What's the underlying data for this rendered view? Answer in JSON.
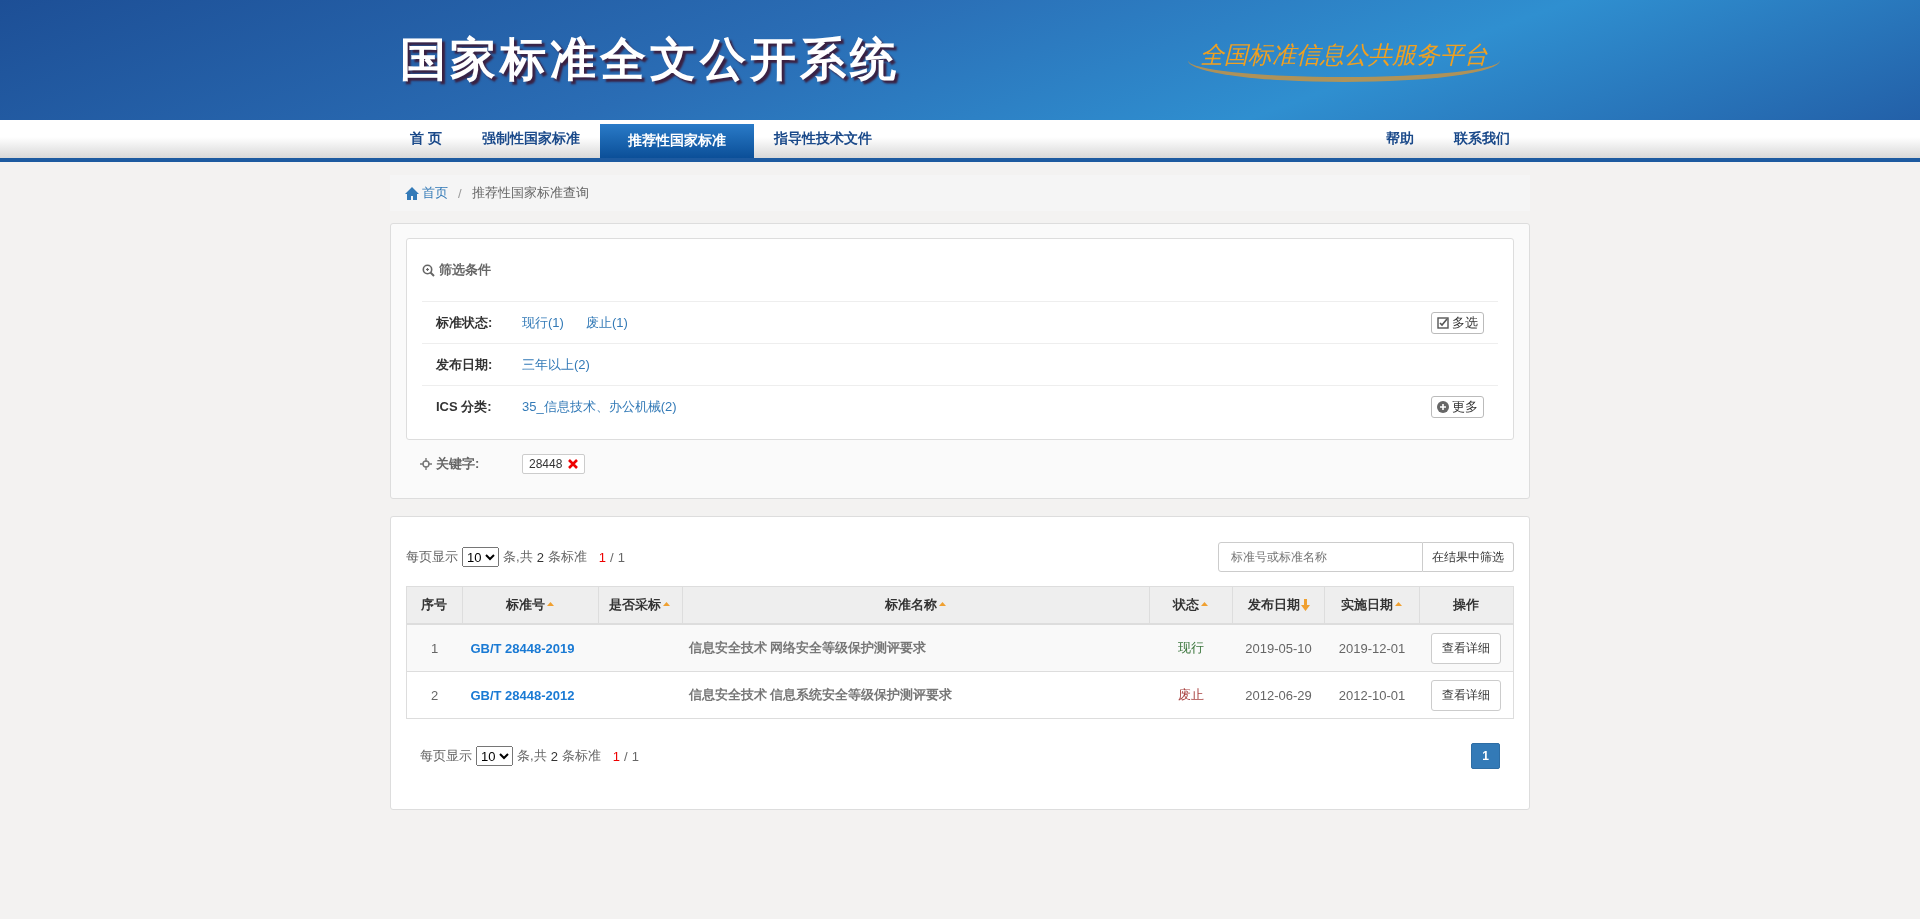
{
  "header": {
    "title": "国家标准全文公开系统",
    "slogan": "全国标准信息公共服务平台"
  },
  "nav": {
    "items": [
      {
        "label": "首 页",
        "selected": false
      },
      {
        "label": "强制性国家标准",
        "selected": false
      },
      {
        "label": "推荐性国家标准",
        "selected": true
      },
      {
        "label": "指导性技术文件",
        "selected": false
      }
    ],
    "right": [
      "帮助",
      "联系我们"
    ]
  },
  "breadcrumb": {
    "home": "首页",
    "separator": "/",
    "current": "推荐性国家标准查询"
  },
  "filter": {
    "title": "筛选条件",
    "rows": [
      {
        "label": "标准状态:",
        "options": [
          "现行(1)",
          "废止(1)"
        ],
        "action": {
          "kind": "multi",
          "label": "多选"
        }
      },
      {
        "label": "发布日期:",
        "options": [
          "三年以上(2)"
        ]
      },
      {
        "label": "ICS 分类:",
        "options": [
          "35_信息技术、办公机械(2)"
        ],
        "action": {
          "kind": "more",
          "label": "更多"
        }
      }
    ],
    "keyword": {
      "label": "关键字:",
      "value": "28448"
    }
  },
  "results": {
    "pager_top": {
      "prefix": "每页显示",
      "size": "10",
      "mid": "条,共",
      "count": "2",
      "unit": "条标准",
      "page": "1",
      "sep": "/",
      "total": "1"
    },
    "search": {
      "placeholder": "标准号或标准名称",
      "button": "在结果中筛选"
    },
    "columns": [
      {
        "label": "序号",
        "kind": "plain"
      },
      {
        "label": "标准号",
        "kind": "sortable"
      },
      {
        "label": "是否采标",
        "kind": "sortable"
      },
      {
        "label": "标准名称",
        "kind": "sortable"
      },
      {
        "label": "状态",
        "kind": "sortable"
      },
      {
        "label": "发布日期",
        "kind": "descending"
      },
      {
        "label": "实施日期",
        "kind": "sortable"
      },
      {
        "label": "操作",
        "kind": "plain"
      }
    ],
    "rows": [
      {
        "no": "1",
        "code": "GB/T 28448-2019",
        "name": "信息安全技术 网络安全等级保护测评要求",
        "status": "现行",
        "color": "#3c763d",
        "published": "2019-05-10",
        "effective": "2019-12-01",
        "action": "查看详细"
      },
      {
        "no": "2",
        "code": "GB/T 28448-2012",
        "name": "信息安全技术 信息系统安全等级保护测评要求",
        "status": "废止",
        "color": "#a94442",
        "published": "2012-06-29",
        "effective": "2012-10-01",
        "action": "查看详细"
      }
    ],
    "pager_bottom": {
      "prefix": "每页显示",
      "size": "10",
      "mid": "条,共",
      "count": "2",
      "unit": "条标准",
      "page": "1",
      "sep": "/",
      "total": "1"
    },
    "pages": [
      {
        "label": "1",
        "selected": true
      }
    ]
  }
}
